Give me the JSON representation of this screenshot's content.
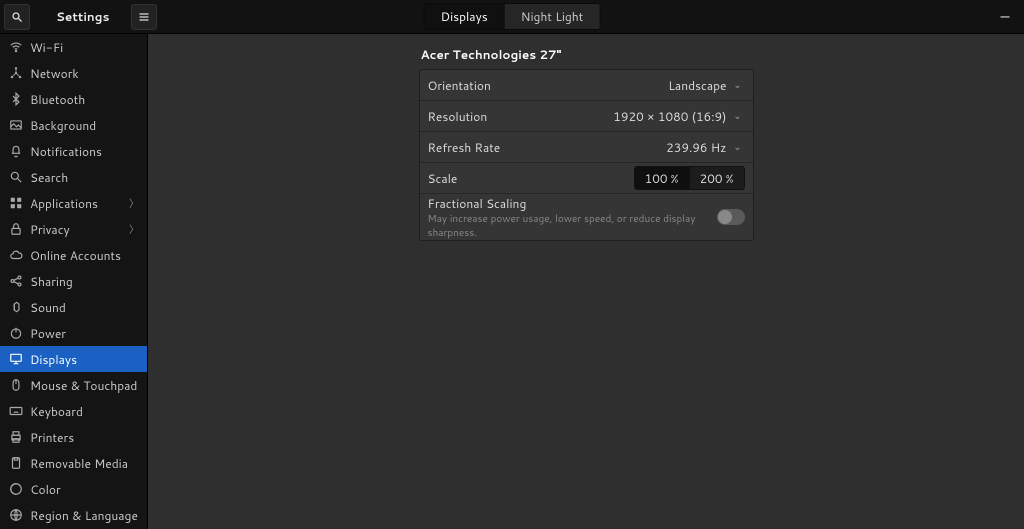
{
  "header": {
    "title": "Settings",
    "tabs": {
      "displays": "Displays",
      "night_light": "Night Light"
    }
  },
  "sidebar": {
    "items": [
      {
        "id": "wifi",
        "label": "Wi-Fi",
        "icon": "wifi",
        "chev": false
      },
      {
        "id": "network",
        "label": "Network",
        "icon": "network",
        "chev": false
      },
      {
        "id": "bluetooth",
        "label": "Bluetooth",
        "icon": "bluetooth",
        "chev": false
      },
      {
        "id": "background",
        "label": "Background",
        "icon": "background",
        "chev": false
      },
      {
        "id": "notifications",
        "label": "Notifications",
        "icon": "bell",
        "chev": false
      },
      {
        "id": "search",
        "label": "Search",
        "icon": "search",
        "chev": false
      },
      {
        "id": "applications",
        "label": "Applications",
        "icon": "apps",
        "chev": true
      },
      {
        "id": "privacy",
        "label": "Privacy",
        "icon": "lock",
        "chev": true
      },
      {
        "id": "online-accounts",
        "label": "Online Accounts",
        "icon": "cloud",
        "chev": false
      },
      {
        "id": "sharing",
        "label": "Sharing",
        "icon": "share",
        "chev": false
      },
      {
        "id": "sound",
        "label": "Sound",
        "icon": "sound",
        "chev": false
      },
      {
        "id": "power",
        "label": "Power",
        "icon": "power",
        "chev": false
      },
      {
        "id": "displays",
        "label": "Displays",
        "icon": "display",
        "chev": false,
        "active": true
      },
      {
        "id": "mouse",
        "label": "Mouse & Touchpad",
        "icon": "mouse",
        "chev": false
      },
      {
        "id": "keyboard",
        "label": "Keyboard",
        "icon": "keyboard",
        "chev": false
      },
      {
        "id": "printers",
        "label": "Printers",
        "icon": "printer",
        "chev": false
      },
      {
        "id": "removable",
        "label": "Removable Media",
        "icon": "usb",
        "chev": false
      },
      {
        "id": "color",
        "label": "Color",
        "icon": "color",
        "chev": false
      },
      {
        "id": "region",
        "label": "Region & Language",
        "icon": "globe",
        "chev": false
      }
    ]
  },
  "display": {
    "name": "Acer Technologies 27\"",
    "orientation": {
      "label": "Orientation",
      "value": "Landscape"
    },
    "resolution": {
      "label": "Resolution",
      "value": "1920 × 1080 (16:9)"
    },
    "refresh": {
      "label": "Refresh Rate",
      "value": "239.96 Hz"
    },
    "scale": {
      "label": "Scale",
      "options": [
        "100 %",
        "200 %"
      ],
      "active": 0
    },
    "fractional": {
      "label": "Fractional Scaling",
      "sub": "May increase power usage, lower speed, or reduce display sharpness.",
      "on": false
    }
  }
}
